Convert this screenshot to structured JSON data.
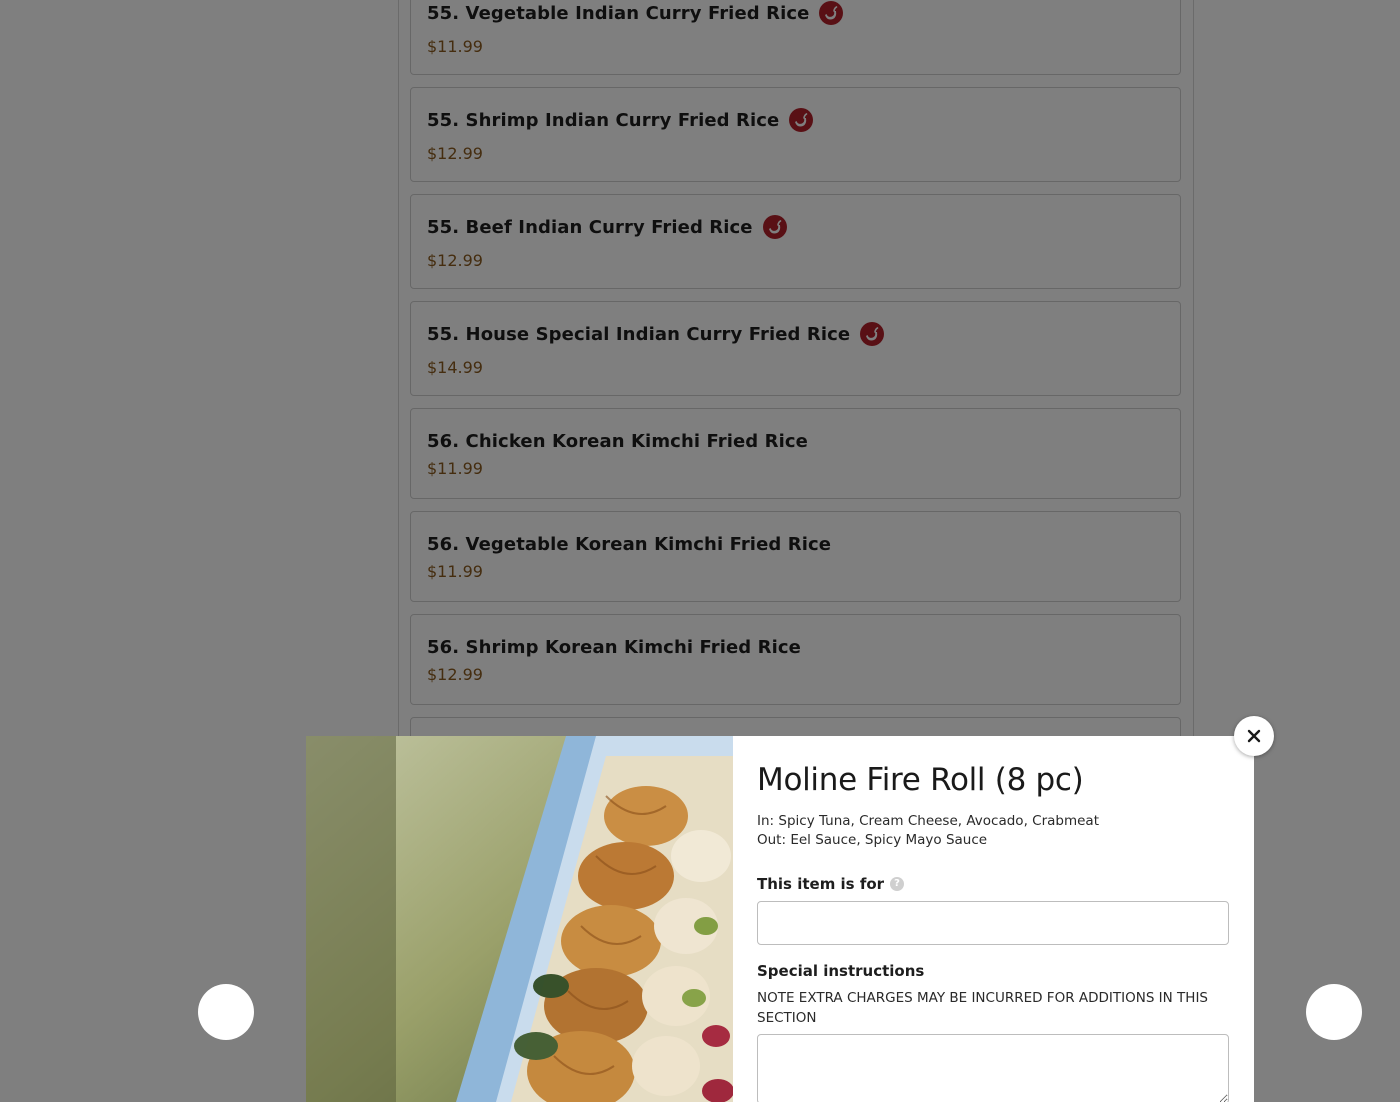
{
  "menu": {
    "items": [
      {
        "name": "55. Vegetable Indian Curry Fried Rice",
        "price": "$11.99",
        "spicy": true
      },
      {
        "name": "55. Shrimp Indian Curry Fried Rice",
        "price": "$12.99",
        "spicy": true
      },
      {
        "name": "55. Beef Indian Curry Fried Rice",
        "price": "$12.99",
        "spicy": true
      },
      {
        "name": "55. House Special Indian Curry Fried Rice",
        "price": "$14.99",
        "spicy": true
      },
      {
        "name": "56. Chicken Korean Kimchi Fried Rice",
        "price": "$11.99",
        "spicy": false
      },
      {
        "name": "56. Vegetable Korean Kimchi Fried Rice",
        "price": "$11.99",
        "spicy": false
      },
      {
        "name": "56. Shrimp Korean Kimchi Fried Rice",
        "price": "$12.99",
        "spicy": false
      },
      {
        "name": "",
        "price": "",
        "spicy": false
      }
    ]
  },
  "modal": {
    "title": "Moline Fire Roll (8 pc)",
    "ingredients_in": "In: Spicy Tuna, Cream Cheese, Avocado, Crabmeat",
    "ingredients_out": "Out: Eel Sauce, Spicy Mayo Sauce",
    "item_for_label": "This item is for",
    "item_for_value": "",
    "special_label": "Special instructions",
    "special_note": "NOTE EXTRA CHARGES MAY BE INCURRED FOR ADDITIONS IN THIS SECTION",
    "special_value": "",
    "help_symbol": "?",
    "close_icon": "close-icon"
  },
  "colors": {
    "price": "#8a5a1e",
    "spicy_badge": "#b3202a",
    "overlay": "rgba(0,0,0,0.5)"
  }
}
